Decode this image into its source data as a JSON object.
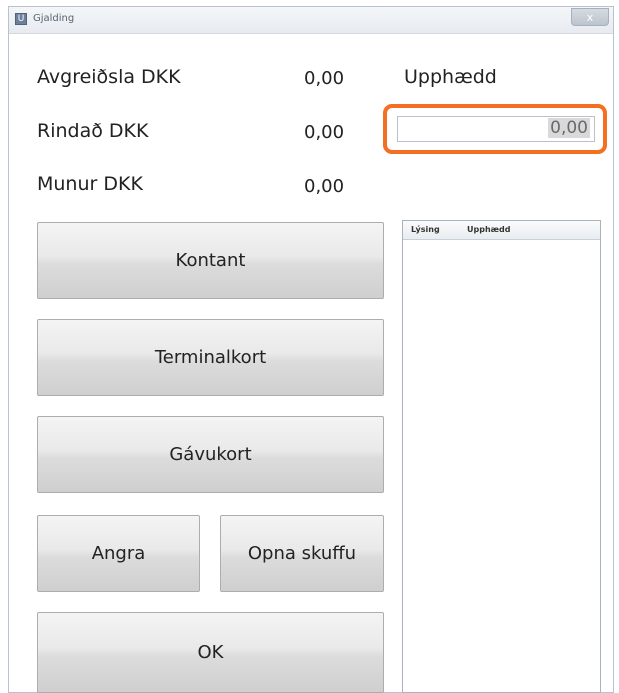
{
  "window": {
    "title": "Gjalding",
    "close_label": "x"
  },
  "summary": {
    "rows": [
      {
        "label": "Avgreiðsla DKK",
        "value": "0,00"
      },
      {
        "label": "Rindað DKK",
        "value": "0,00"
      },
      {
        "label": "Munur DKK",
        "value": "0,00"
      }
    ]
  },
  "amount": {
    "label": "Upphædd",
    "value": "0,00"
  },
  "buttons": {
    "cash": "Kontant",
    "terminal_card": "Terminalkort",
    "gift_card": "Gávukort",
    "undo": "Angra",
    "open_drawer": "Opna skuffu",
    "ok": "OK"
  },
  "list": {
    "columns": [
      "Lýsing",
      "Upphædd"
    ],
    "rows": []
  },
  "colors": {
    "highlight_border": "#f36f21"
  }
}
